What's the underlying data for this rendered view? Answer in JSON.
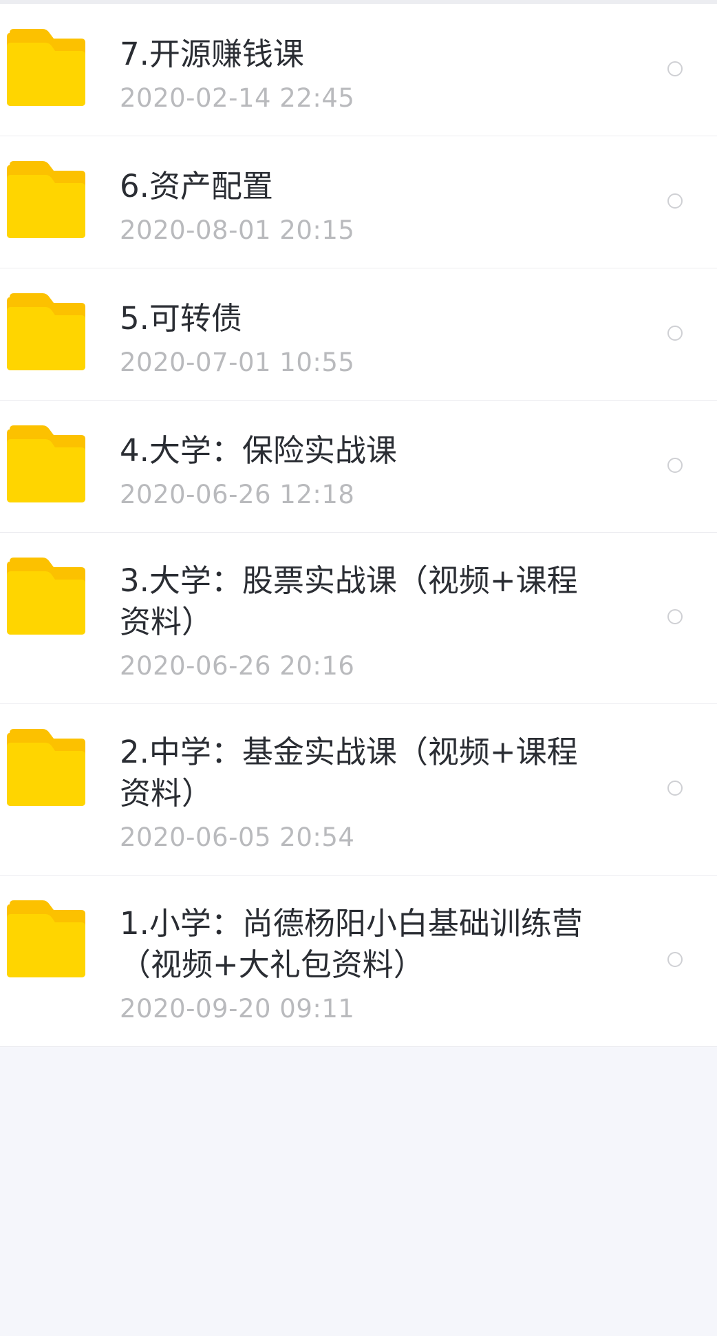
{
  "colors": {
    "folder": "#ffd500",
    "folder_tab": "#fcc100",
    "background": "#f5f6fb",
    "name_text": "#2a2d33",
    "date_text": "#b9babd"
  },
  "files": [
    {
      "name": "7.开源赚钱课",
      "date": "2020-02-14  22:45",
      "icon": "folder-icon"
    },
    {
      "name": "6.资产配置",
      "date": "2020-08-01  20:15",
      "icon": "folder-icon"
    },
    {
      "name": "5.可转债",
      "date": "2020-07-01  10:55",
      "icon": "folder-icon"
    },
    {
      "name": "4.大学：保险实战课",
      "date": "2020-06-26  12:18",
      "icon": "folder-icon"
    },
    {
      "name": "3.大学：股票实战课（视频+课程\n资料）",
      "date": "2020-06-26  20:16",
      "icon": "folder-icon"
    },
    {
      "name": "2.中学：基金实战课（视频+课程\n资料）",
      "date": "2020-06-05  20:54",
      "icon": "folder-icon"
    },
    {
      "name": "1.小学：尚德杨阳小白基础训练营\n（视频+大礼包资料）",
      "date": "2020-09-20  09:11",
      "icon": "folder-icon"
    }
  ]
}
